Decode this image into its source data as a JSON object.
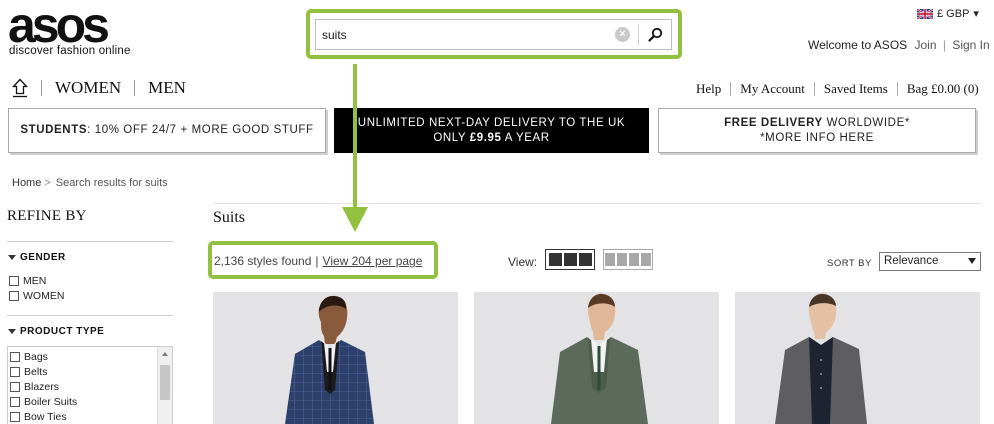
{
  "header": {
    "logo_text": "asos",
    "logo_tagline": "discover fashion online",
    "search": {
      "value": "suits",
      "placeholder": ""
    },
    "currency": {
      "label": "£ GBP",
      "caret": "▾"
    },
    "welcome": "Welcome to ASOS",
    "join": "Join",
    "sign_in": "Sign In"
  },
  "nav": {
    "main": [
      "WOMEN",
      "MEN"
    ],
    "secondary": [
      "Help",
      "My Account",
      "Saved Items",
      "Bag £0.00 (0)"
    ]
  },
  "banners": {
    "students_bold": "STUDENTS",
    "students_rest": ": 10% OFF 24/7 + MORE GOOD STUFF",
    "delivery_line1": "UNLIMITED NEXT-DAY DELIVERY TO THE UK",
    "delivery_line2_pre": "ONLY",
    "delivery_line2_price": "£9.95",
    "delivery_line2_post": "A YEAR",
    "free_bold": "FREE DELIVERY",
    "free_rest": " WORLDWIDE*",
    "free_line2": "*MORE INFO HERE"
  },
  "breadcrumb": {
    "home": "Home",
    "sep": ">",
    "current": "Search results for suits"
  },
  "sidebar": {
    "title": "REFINE BY",
    "gender": {
      "title": "GENDER",
      "options": [
        "MEN",
        "WOMEN"
      ]
    },
    "product_type": {
      "title": "PRODUCT TYPE",
      "options": [
        "Bags",
        "Belts",
        "Blazers",
        "Boiler Suits",
        "Bow Ties"
      ]
    }
  },
  "results": {
    "title": "Suits",
    "count": "2,136 styles found",
    "sep": "|",
    "per_page_link": "View 204 per page",
    "view_label": "View:",
    "sort_label": "SORT BY",
    "sort_value": "Relevance"
  },
  "colors": {
    "highlight": "#92c03f",
    "banner_dark": "#000000",
    "product_bg": "#e3e3e5"
  }
}
